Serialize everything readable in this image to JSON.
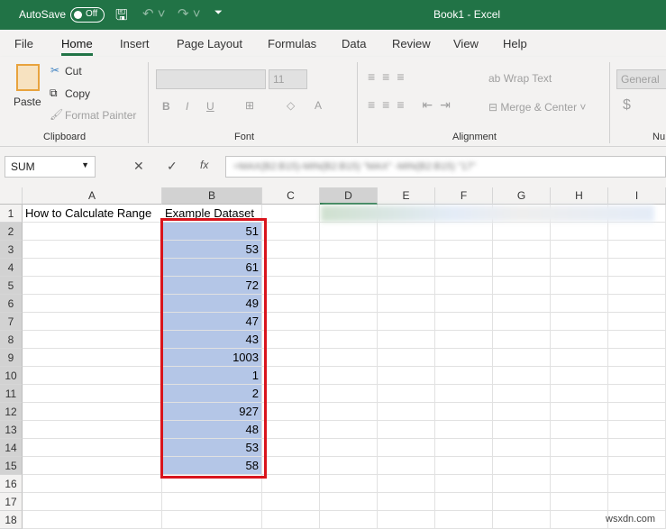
{
  "title_bar": {
    "autosave": "AutoSave",
    "toggle": "Off",
    "title": "Book1  -  Excel"
  },
  "tabs": [
    "File",
    "Home",
    "Insert",
    "Page Layout",
    "Formulas",
    "Data",
    "Review",
    "View",
    "Help"
  ],
  "ribbon": {
    "paste": "Paste",
    "cut": "Cut",
    "copy": "Copy",
    "format_painter": "Format Painter",
    "clipboard": "Clipboard",
    "font_size": "11",
    "font": "Font",
    "wrap_text": "Wrap Text",
    "merge_center": "Merge & Center",
    "alignment": "Alignment",
    "number_format": "General",
    "number": "Nu",
    "bold": "B",
    "italic": "I",
    "underline": "U",
    "currency": "$"
  },
  "formula_bar": {
    "name_box": "SUM",
    "fx": "fx",
    "formula": "=MAX(B2:B15)-MIN(B2:B15) \"MAX\" -MIN(B2:B15) \"17\""
  },
  "columns": [
    "A",
    "B",
    "C",
    "D",
    "E",
    "F",
    "G",
    "H",
    "I"
  ],
  "rows": [
    "1",
    "2",
    "3",
    "4",
    "5",
    "6",
    "7",
    "8",
    "9",
    "10",
    "11",
    "12",
    "13",
    "14",
    "15",
    "16",
    "17",
    "18"
  ],
  "cells": {
    "A1": "How to Calculate Range",
    "B1": "Example Dataset",
    "B_values": [
      "51",
      "53",
      "61",
      "72",
      "49",
      "47",
      "43",
      "1003",
      "1",
      "2",
      "927",
      "48",
      "53",
      "58"
    ]
  },
  "watermark": "wsxdn.com"
}
